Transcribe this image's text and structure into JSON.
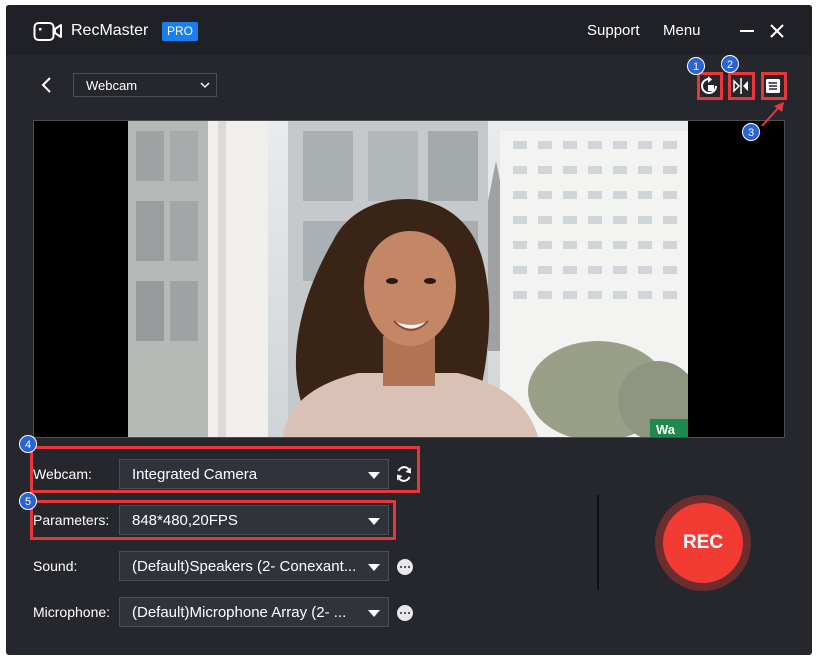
{
  "app": {
    "name": "RecMaster",
    "badge": "PRO"
  },
  "header": {
    "support": "Support",
    "menu": "Menu"
  },
  "toolbar": {
    "mode": "Webcam"
  },
  "annotations": [
    "1",
    "2",
    "3",
    "4",
    "5"
  ],
  "settings": {
    "webcam": {
      "label": "Webcam:",
      "value": "Integrated Camera"
    },
    "parameters": {
      "label": "Parameters:",
      "value": "848*480,20FPS"
    },
    "sound": {
      "label": "Sound:",
      "value": "(Default)Speakers (2- Conexant..."
    },
    "microphone": {
      "label": "Microphone:",
      "value": "(Default)Microphone Array (2- ..."
    }
  },
  "record": {
    "label": "REC"
  },
  "preview": {
    "sign_text": "Wa"
  },
  "colors": {
    "accent": "#1b7ef0",
    "rec": "#f23c33",
    "highlight": "#e8363b",
    "marker": "#2a63d6"
  }
}
